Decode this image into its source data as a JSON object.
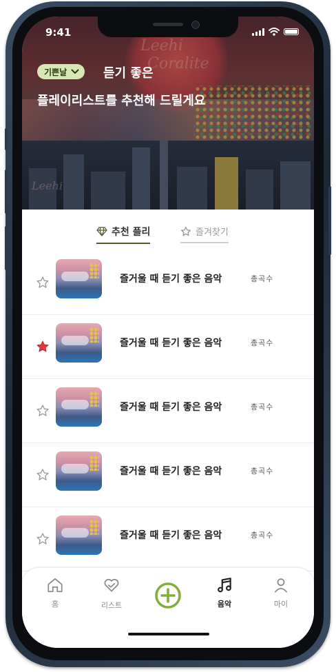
{
  "status_bar": {
    "time": "9:41"
  },
  "header": {
    "mood_selector": "기쁜날",
    "title_line1": "듣기 좋은",
    "title_line2": "플레이리스트를 추천해 드릴게요",
    "artwork_text": [
      "Leehi",
      "Coralite"
    ]
  },
  "tabs": [
    {
      "label": "추천 플리",
      "active": true
    },
    {
      "label": "즐겨찾기",
      "active": false
    }
  ],
  "playlists": [
    {
      "title": "즐거울 때 듣기 좋은 음악",
      "count_label": "총곡수",
      "favorited": false
    },
    {
      "title": "즐거울 때 듣기 좋은 음악",
      "count_label": "총곡수",
      "favorited": true
    },
    {
      "title": "즐거울 때 듣기 좋은 음악",
      "count_label": "총곡수",
      "favorited": false
    },
    {
      "title": "즐거울 때 듣기 좋은 음악",
      "count_label": "총곡수",
      "favorited": false
    },
    {
      "title": "즐거울 때 듣기 좋은 음악",
      "count_label": "총곡수",
      "favorited": false
    }
  ],
  "bottom_nav": [
    {
      "label": "홈",
      "icon": "home-icon"
    },
    {
      "label": "리스트",
      "icon": "heart-list-icon"
    },
    {
      "label": "",
      "icon": "add-circle-icon"
    },
    {
      "label": "음악",
      "icon": "music-note-icon",
      "active": true
    },
    {
      "label": "마이",
      "icon": "user-icon"
    }
  ],
  "colors": {
    "accent_green": "#7fb03a",
    "pill_bg": "#d8e8b4",
    "star_active": "#e0393e",
    "tab_underline": "#4b5a2e"
  }
}
